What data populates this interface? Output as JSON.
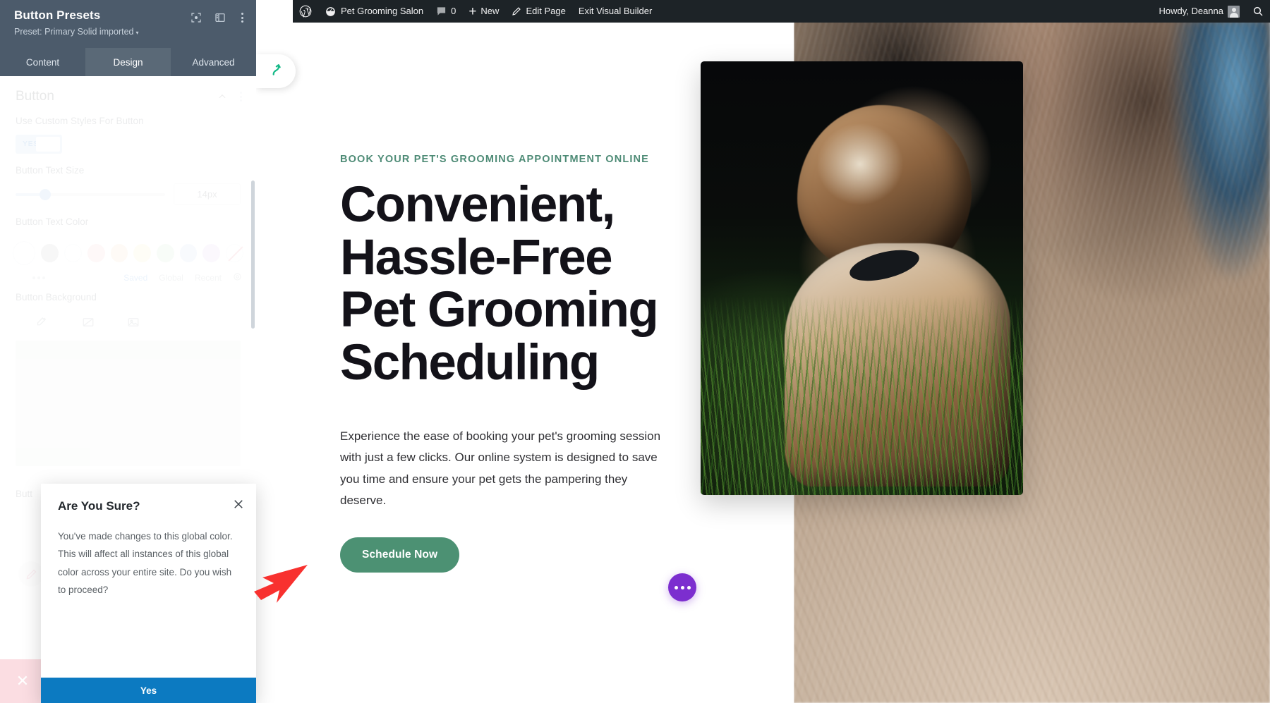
{
  "adminbar": {
    "site_name": "Pet Grooming Salon",
    "comment_count": "0",
    "new_label": "New",
    "edit_page_label": "Edit Page",
    "exit_builder_label": "Exit Visual Builder",
    "howdy": "Howdy, Deanna",
    "icons": {
      "wordpress": "wordpress-logo-icon",
      "dashboard": "dashboard-icon",
      "comments": "comment-bubble-icon",
      "new": "plus-icon",
      "edit": "pencil-icon",
      "avatar": "user-avatar-icon",
      "search": "search-icon"
    }
  },
  "panel": {
    "title": "Button Presets",
    "subtitle": "Preset: Primary Solid imported",
    "subtitle_caret": "▾",
    "head_icons": {
      "focus": "focus-target-icon",
      "layout": "panel-layout-icon",
      "more": "kebab-menu-icon"
    },
    "tabs": [
      {
        "label": "Content",
        "active": false
      },
      {
        "label": "Design",
        "active": true
      },
      {
        "label": "Advanced",
        "active": false
      }
    ],
    "section": {
      "title": "Button",
      "collapse_icon": "chevron-up-icon",
      "more_icon": "kebab-menu-icon"
    },
    "fields": {
      "custom_styles": {
        "label": "Use Custom Styles For Button",
        "toggle_value": "YES"
      },
      "text_size": {
        "label": "Button Text Size",
        "value": "14px"
      },
      "text_color": {
        "label": "Button Text Color",
        "swatches": [
          "#ffffff",
          "#b5b5b5",
          "#ffffff",
          "#f9bdbd",
          "#f7d6ae",
          "#f7f0ad",
          "#c4e6bd",
          "#c2d8f2",
          "#dfc2f2",
          "none"
        ],
        "tabs": [
          "Saved",
          "Global",
          "Recent"
        ],
        "active_tab": "Saved",
        "gear_icon": "gear-icon",
        "more_icon": "ellipsis-icon"
      },
      "background": {
        "label": "Button Background",
        "preview_color": "#e7efec"
      },
      "truncated_label": "Butt"
    },
    "edit_icon": "pencil-circle-icon",
    "close_icon": "close-icon"
  },
  "modal": {
    "title": "Are You Sure?",
    "body": "You've made changes to this global color. This will affect all instances of this global color across your entire site. Do you wish to proceed?",
    "confirm_label": "Yes",
    "close_icon": "close-icon",
    "confirm_color": "#0c7ac1"
  },
  "page": {
    "eyebrow": "BOOK YOUR PET'S GROOMING APPOINTMENT ONLINE",
    "heading": "Convenient, Hassle-Free Pet Grooming Scheduling",
    "paragraph": "Experience the ease of booking your pet's grooming session with just a few clicks. Our online system is designed to save you time and ensure your pet gets the pampering they deserve.",
    "cta_label": "Schedule Now",
    "cta_color": "#4c9173",
    "eyebrow_color": "#4e8b76",
    "builder_pill_icon": "arrow-curve-up-icon",
    "fab_icon": "ellipsis-icon",
    "fab_color": "#7c2ecf",
    "hero_image_alt": "cat-photo"
  },
  "annotation": {
    "arrow_color": "#f8312f",
    "arrow_icon": "pointer-arrow-icon"
  }
}
